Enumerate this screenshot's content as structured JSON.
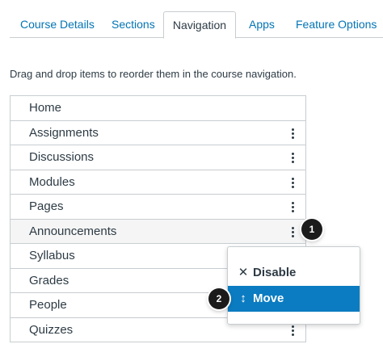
{
  "tabs": [
    {
      "label": "Course Details",
      "active": false
    },
    {
      "label": "Sections",
      "active": false
    },
    {
      "label": "Navigation",
      "active": true
    },
    {
      "label": "Apps",
      "active": false
    },
    {
      "label": "Feature Options",
      "active": false
    }
  ],
  "instructions": "Drag and drop items to reorder them in the course navigation.",
  "nav_items": [
    {
      "label": "Home",
      "has_menu": false
    },
    {
      "label": "Assignments",
      "has_menu": true
    },
    {
      "label": "Discussions",
      "has_menu": true
    },
    {
      "label": "Modules",
      "has_menu": true
    },
    {
      "label": "Pages",
      "has_menu": true
    },
    {
      "label": "Announcements",
      "has_menu": true
    },
    {
      "label": "Syllabus",
      "has_menu": true
    },
    {
      "label": "Grades",
      "has_menu": true
    },
    {
      "label": "People",
      "has_menu": true
    },
    {
      "label": "Quizzes",
      "has_menu": true
    }
  ],
  "menu": {
    "disable_label": "Disable",
    "disable_icon": "close-icon",
    "move_label": "Move",
    "move_icon": "move-vertical-icon"
  },
  "callouts": {
    "first": "1",
    "second": "2"
  },
  "colors": {
    "link": "#0374b5",
    "text": "#2d3b45",
    "border": "#c7cdd1",
    "menu_highlight": "#0b7cc1",
    "badge": "#1b1b1b"
  }
}
